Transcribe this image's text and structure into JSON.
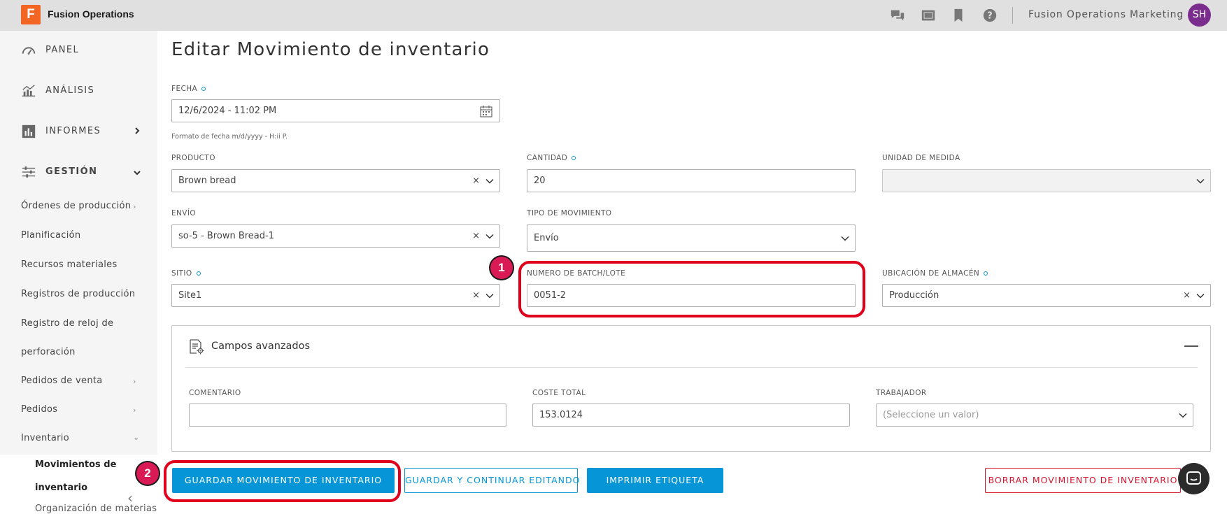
{
  "app": {
    "logo_letter": "F",
    "title": "Fusion Operations"
  },
  "topbar": {
    "user_name": "Fusion Operations Marketing",
    "avatar_initials": "SH"
  },
  "sidebar": {
    "main_items": [
      {
        "label": "PANEL"
      },
      {
        "label": "ANÁLISIS"
      },
      {
        "label": "INFORMES"
      },
      {
        "label": "GESTIÓN"
      }
    ],
    "sub_items": [
      {
        "label": "Órdenes de producción"
      },
      {
        "label": "Planificación"
      },
      {
        "label": "Recursos materiales"
      },
      {
        "label": "Registros de producción"
      },
      {
        "label": "Registro de reloj de"
      },
      {
        "label": "perforación"
      },
      {
        "label": "Pedidos de venta"
      },
      {
        "label": "Pedidos"
      },
      {
        "label": "Inventario"
      }
    ],
    "active_item": {
      "line1": "Movimientos de",
      "line2": "inventario"
    },
    "next_item": "Organización de materias"
  },
  "page": {
    "title": "Editar Movimiento de inventario"
  },
  "form": {
    "fecha": {
      "label": "FECHA",
      "value": "12/6/2024 - 11:02 PM",
      "hint": "Formato de fecha m/d/yyyy - H:ii P."
    },
    "producto": {
      "label": "PRODUCTO",
      "value": "Brown bread"
    },
    "cantidad": {
      "label": "CANTIDAD",
      "value": "20"
    },
    "unidad": {
      "label": "UNIDAD DE MEDIDA",
      "value": ""
    },
    "envio": {
      "label": "ENVÍO",
      "value": "so-5 - Brown Bread-1"
    },
    "tipo": {
      "label": "TIPO DE MOVIMIENTO",
      "value": "Envío"
    },
    "sitio": {
      "label": "SITIO",
      "value": "Site1"
    },
    "lote": {
      "label": "NUMERO DE BATCH/LOTE",
      "value": "0051-2"
    },
    "ubicacion": {
      "label": "UBICACIÓN DE ALMACÉN",
      "value": "Producción"
    }
  },
  "advanced": {
    "title": "Campos avanzados",
    "comentario": {
      "label": "COMENTARIO",
      "value": ""
    },
    "coste": {
      "label": "COSTE TOTAL",
      "value": "153.0124"
    },
    "trabajador": {
      "label": "TRABAJADOR",
      "placeholder": "(Seleccione un valor)"
    }
  },
  "buttons": {
    "save": "GUARDAR MOVIMIENTO DE INVENTARIO",
    "save_continue": "GUARDAR Y CONTINUAR EDITANDO",
    "print": "IMPRIMIR ETIQUETA",
    "delete": "BORRAR MOVIMIENTO DE INVENTARIO"
  },
  "annotations": {
    "badge1": "1",
    "badge2": "2"
  },
  "colors": {
    "accent": "#0696d7",
    "danger": "#d6162f",
    "highlight": "#e0001b",
    "badge": "#d91a55",
    "avatar": "#7b2d8e",
    "logo": "#f26522"
  }
}
